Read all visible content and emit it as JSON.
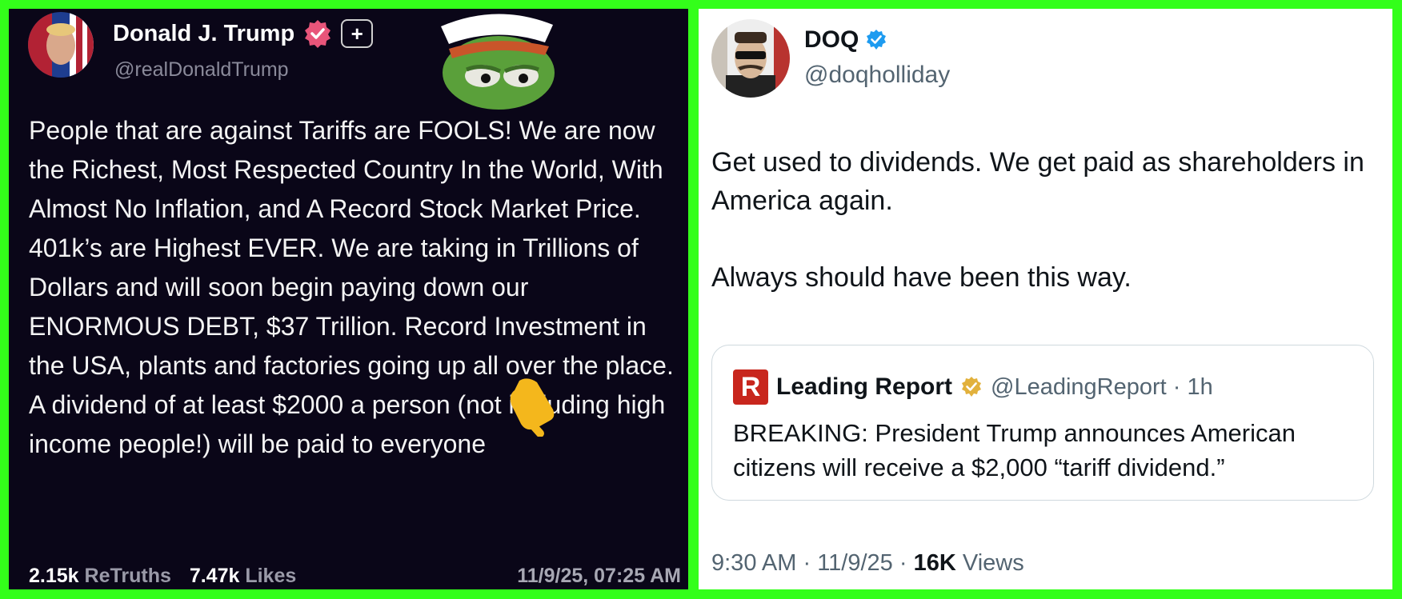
{
  "left_post": {
    "name": "Donald J. Trump",
    "handle": "@realDonaldTrump",
    "plus_label": "+",
    "body": "People that are against Tariffs are FOOLS! We are now the Richest, Most Respected Country In the World, With Almost No Inflation, and A Record Stock Market Price. 401k’s are Highest EVER. We are taking in Trillions of Dollars and will soon begin paying down our ENORMOUS DEBT, $37 Trillion. Record Investment in the USA, plants and factories going up all over the place. A dividend of at least $2000 a person (not including high income people!) will be paid to everyone",
    "retruths_count": "2.15k",
    "retruths_label": "ReTruths",
    "likes_count": "7.47k",
    "likes_label": "Likes",
    "timestamp": "11/9/25, 07:25 AM"
  },
  "right_post": {
    "name": "DOQ",
    "handle": "@doqholliday",
    "body_line1": "Get used to dividends. We get paid as shareholders in America again.",
    "body_line2": "Always should have been this way.",
    "quote": {
      "logo_letter": "R",
      "name": "Leading Report",
      "handle_time": "@LeadingReport · 1h",
      "body": "BREAKING: President Trump announces American citizens will receive a $2,000 “tariff dividend.”"
    },
    "time": "9:30 AM",
    "sep1": "·",
    "date": "11/9/25",
    "sep2": "·",
    "views_count": "16K",
    "views_label": "Views"
  },
  "colors": {
    "frame": "#33ff1a",
    "left_bg": "#0a0618",
    "verified_pink": "#e8557a",
    "verified_blue": "#1d9bf0",
    "gold_badge": "#e2b13c",
    "leading_red": "#c8261d"
  }
}
